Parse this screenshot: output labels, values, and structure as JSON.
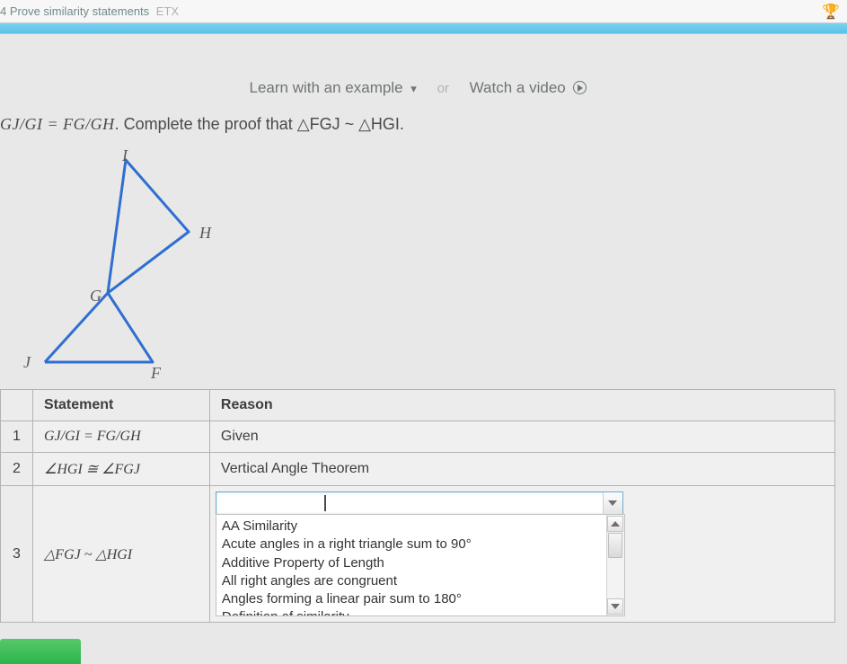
{
  "topbar": {
    "title_prefix": "4 Prove similarity statements",
    "title_suffix": "ETX"
  },
  "helpers": {
    "learn": "Learn with an example",
    "or": "or",
    "watch": "Watch a video"
  },
  "problem": {
    "lead": "GJ/GI = FG/GH",
    "tail": ". Complete the proof that △FGJ ~ △HGI."
  },
  "figure": {
    "labels": {
      "I": "I",
      "H": "H",
      "G": "G",
      "F": "F",
      "J": "J"
    }
  },
  "table": {
    "headers": {
      "num": "",
      "statement": "Statement",
      "reason": "Reason"
    },
    "rows": [
      {
        "n": "1",
        "statement": "GJ/GI = FG/GH",
        "reason": "Given"
      },
      {
        "n": "2",
        "statement": "∠HGI ≅ ∠FGJ",
        "reason": "Vertical Angle Theorem"
      },
      {
        "n": "3",
        "statement": "△FGJ ~ △HGI",
        "reason": ""
      }
    ]
  },
  "dropdown": {
    "options": [
      "AA Similarity",
      "Acute angles in a right triangle sum to 90°",
      "Additive Property of Length",
      "All right angles are congruent",
      "Angles forming a linear pair sum to 180°",
      "Definition of similarity"
    ]
  }
}
